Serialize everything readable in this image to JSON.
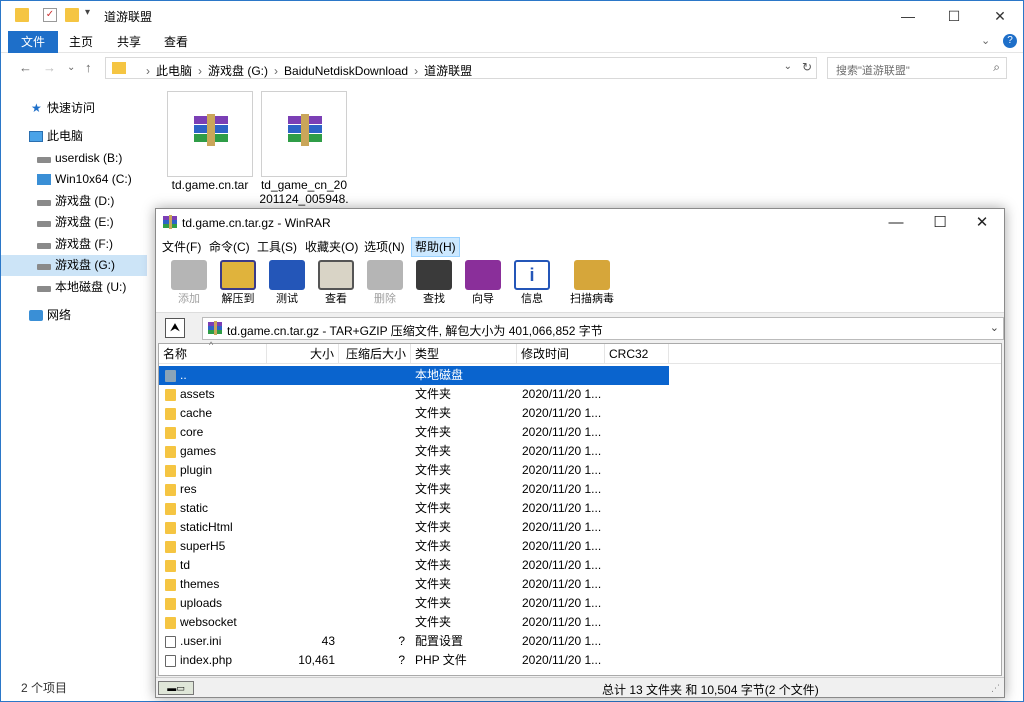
{
  "explorer": {
    "title": "道游联盟",
    "ribbon_tabs": [
      "文件",
      "主页",
      "共享",
      "查看"
    ],
    "address": {
      "segments": [
        "此电脑",
        "游戏盘 (G:)",
        "BaiduNetdiskDownload",
        "道游联盟"
      ]
    },
    "search_placeholder": "搜索\"道游联盟\"",
    "nav": {
      "quick_access": "快速访问",
      "this_pc": "此电脑",
      "drives": [
        "userdisk (B:)",
        "Win10x64 (C:)",
        "游戏盘 (D:)",
        "游戏盘 (E:)",
        "游戏盘 (F:)",
        "游戏盘 (G:)",
        "本地磁盘 (U:)"
      ],
      "network": "网络"
    },
    "files": [
      {
        "name_line1": "td.game.cn.tar",
        "name_line2": ""
      },
      {
        "name_line1": "td_game_cn_20",
        "name_line2": "201124_005948."
      }
    ],
    "status": "2 个项目"
  },
  "winrar": {
    "title": "td.game.cn.tar.gz - WinRAR",
    "menu": [
      "文件(F)",
      "命令(C)",
      "工具(S)",
      "收藏夹(O)",
      "选项(N)",
      "帮助(H)"
    ],
    "toolbar": [
      "添加",
      "解压到",
      "测试",
      "查看",
      "删除",
      "查找",
      "向导",
      "信息",
      "扫描病毒"
    ],
    "path": "td.game.cn.tar.gz - TAR+GZIP 压缩文件, 解包大小为 401,066,852 字节",
    "columns": [
      "名称",
      "大小",
      "压缩后大小",
      "类型",
      "修改时间",
      "CRC32"
    ],
    "rows": [
      {
        "name": "..",
        "size": "",
        "packed": "",
        "type": "本地磁盘",
        "modified": "",
        "kind": "up"
      },
      {
        "name": "assets",
        "size": "",
        "packed": "",
        "type": "文件夹",
        "modified": "2020/11/20 1...",
        "kind": "folder"
      },
      {
        "name": "cache",
        "size": "",
        "packed": "",
        "type": "文件夹",
        "modified": "2020/11/20 1...",
        "kind": "folder"
      },
      {
        "name": "core",
        "size": "",
        "packed": "",
        "type": "文件夹",
        "modified": "2020/11/20 1...",
        "kind": "folder"
      },
      {
        "name": "games",
        "size": "",
        "packed": "",
        "type": "文件夹",
        "modified": "2020/11/20 1...",
        "kind": "folder"
      },
      {
        "name": "plugin",
        "size": "",
        "packed": "",
        "type": "文件夹",
        "modified": "2020/11/20 1...",
        "kind": "folder"
      },
      {
        "name": "res",
        "size": "",
        "packed": "",
        "type": "文件夹",
        "modified": "2020/11/20 1...",
        "kind": "folder"
      },
      {
        "name": "static",
        "size": "",
        "packed": "",
        "type": "文件夹",
        "modified": "2020/11/20 1...",
        "kind": "folder"
      },
      {
        "name": "staticHtml",
        "size": "",
        "packed": "",
        "type": "文件夹",
        "modified": "2020/11/20 1...",
        "kind": "folder"
      },
      {
        "name": "superH5",
        "size": "",
        "packed": "",
        "type": "文件夹",
        "modified": "2020/11/20 1...",
        "kind": "folder"
      },
      {
        "name": "td",
        "size": "",
        "packed": "",
        "type": "文件夹",
        "modified": "2020/11/20 1...",
        "kind": "folder"
      },
      {
        "name": "themes",
        "size": "",
        "packed": "",
        "type": "文件夹",
        "modified": "2020/11/20 1...",
        "kind": "folder"
      },
      {
        "name": "uploads",
        "size": "",
        "packed": "",
        "type": "文件夹",
        "modified": "2020/11/20 1...",
        "kind": "folder"
      },
      {
        "name": "websocket",
        "size": "",
        "packed": "",
        "type": "文件夹",
        "modified": "2020/11/20 1...",
        "kind": "folder"
      },
      {
        "name": ".user.ini",
        "size": "43",
        "packed": "?",
        "type": "配置设置",
        "modified": "2020/11/20 1...",
        "kind": "file"
      },
      {
        "name": "index.php",
        "size": "10,461",
        "packed": "?",
        "type": "PHP 文件",
        "modified": "2020/11/20 1...",
        "kind": "file"
      }
    ],
    "status": "总计 13 文件夹 和 10,504 字节(2 个文件)"
  }
}
